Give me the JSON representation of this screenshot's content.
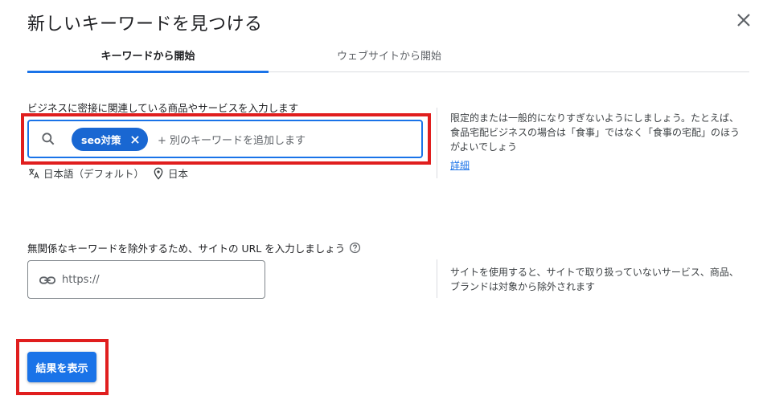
{
  "dialog": {
    "title": "新しいキーワードを見つける",
    "close_icon": "close-icon"
  },
  "tabs": [
    {
      "label": "キーワードから開始",
      "selected": true
    },
    {
      "label": "ウェブサイトから開始",
      "selected": false
    }
  ],
  "keywords": {
    "label": "ビジネスに密接に関連している商品やサービスを入力します",
    "chip": "seo対策",
    "placeholder": "+ 別のキーワードを追加します",
    "language": "日本語（デフォルト）",
    "location": "日本",
    "help": "限定的または一般的になりすぎないようにしましょう。たとえば、食品宅配ビジネスの場合は「食事」ではなく「食事の宅配」のほうがよいでしょう",
    "help_link": "詳細"
  },
  "site": {
    "label": "無関係なキーワードを除外するため、サイトの URL を入力しましょう",
    "placeholder": "https://",
    "help": "サイトを使用すると、サイトで取り扱っていないサービス、商品、ブランドは対象から除外されます"
  },
  "actions": {
    "submit_label": "結果を表示"
  },
  "colors": {
    "accent": "#1a73e8",
    "highlight": "#e01e1e"
  }
}
